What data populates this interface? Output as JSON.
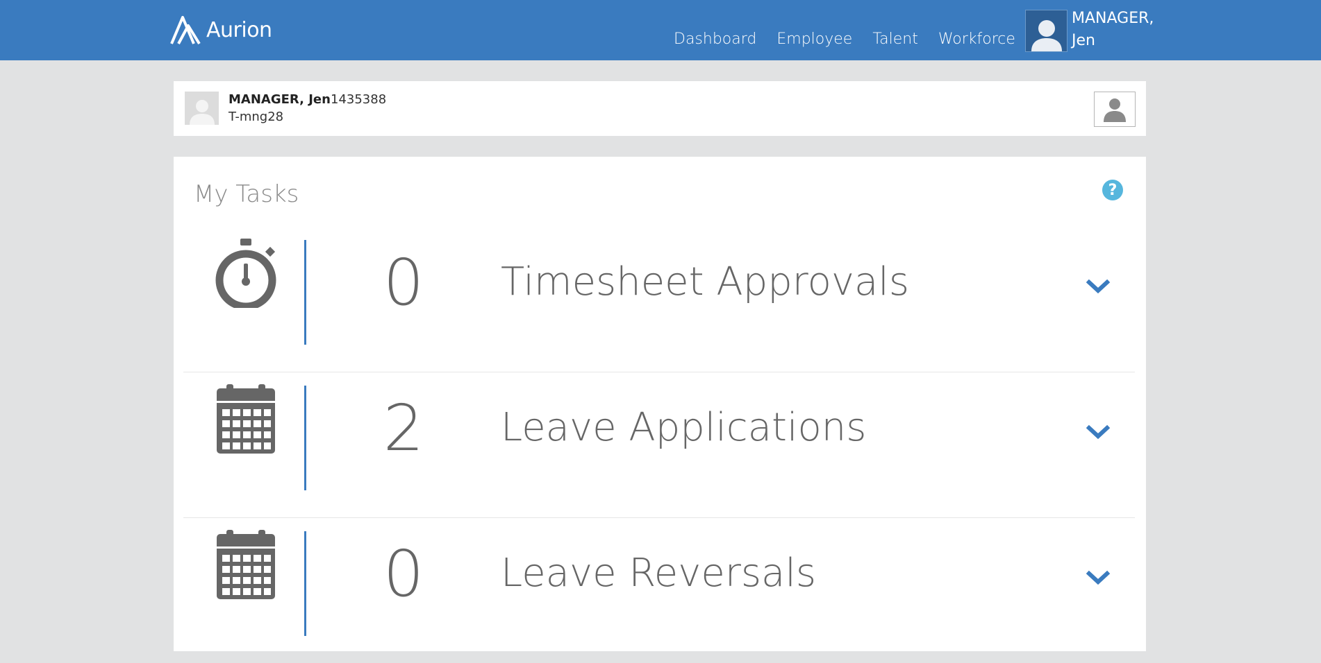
{
  "brand": {
    "name": "Aurion"
  },
  "nav": {
    "items": [
      {
        "label": "Dashboard"
      },
      {
        "label": "Employee"
      },
      {
        "label": "Talent"
      },
      {
        "label": "Workforce"
      }
    ]
  },
  "user_menu": {
    "name_line1": "MANAGER,",
    "name_line2": "Jen"
  },
  "profile": {
    "name": "MANAGER, Jen",
    "employee_id": "1435388",
    "code": "T-mng28"
  },
  "tasks": {
    "title": "My Tasks",
    "help_icon": "question-icon",
    "items": [
      {
        "icon": "stopwatch-icon",
        "count": "0",
        "label": "Timesheet Approvals"
      },
      {
        "icon": "calendar-icon",
        "count": "2",
        "label": "Leave Applications"
      },
      {
        "icon": "calendar-icon",
        "count": "0",
        "label": "Leave Reversals"
      }
    ]
  },
  "colors": {
    "header": "#3a7bbf",
    "accent": "#3a7bbf",
    "help": "#56b6dd",
    "background": "#e1e2e3"
  }
}
